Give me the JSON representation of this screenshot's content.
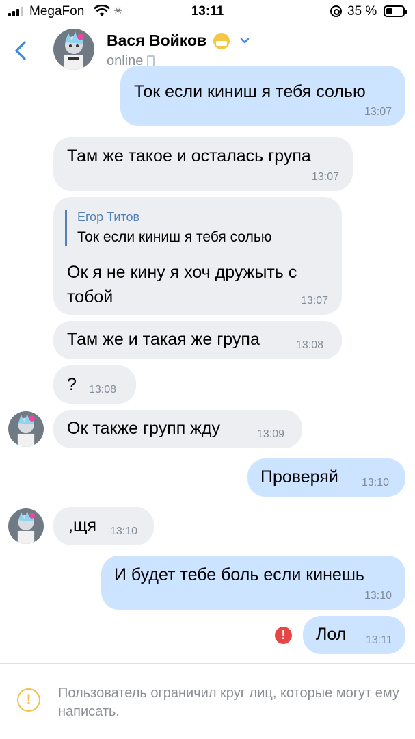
{
  "status_bar": {
    "carrier": "MegaFon",
    "time": "13:11",
    "battery": "35 %"
  },
  "header": {
    "title": "Вася Войков",
    "subtitle": "online",
    "icons": [
      "back-chevron-icon",
      "avatar",
      "mask-emoji-icon",
      "chevron-down-icon",
      "phone-icon"
    ]
  },
  "messages": [
    {
      "side": "out",
      "text": "Ток если киниш я тебя солью",
      "time": "13:07"
    },
    {
      "side": "in",
      "text": "Там же такое и осталась група",
      "time": "13:07"
    },
    {
      "side": "in",
      "reply_name": "Егор Титов",
      "reply_text": "Ток если киниш я тебя солью",
      "text": "Ок я не кину я хоч дружыть с тобой",
      "time": "13:07"
    },
    {
      "side": "in",
      "text": "Там же и такая же група",
      "time": "13:08"
    },
    {
      "side": "in",
      "text": "?",
      "time": "13:08"
    },
    {
      "side": "in",
      "text": "Ок также групп жду",
      "time": "13:09"
    },
    {
      "side": "out",
      "text": "Проверяй",
      "time": "13:10"
    },
    {
      "side": "in",
      "text": ",щя",
      "time": "13:10"
    },
    {
      "side": "out",
      "text": "И будет тебе боль если кинешь",
      "time": "13:10"
    },
    {
      "side": "out",
      "text": "Лол",
      "time": "13:11",
      "status": "error"
    }
  ],
  "footer": {
    "notice": "Пользователь ограничил круг лиц, которые могут ему написать."
  },
  "colors": {
    "incoming": "#eceef1",
    "outgoing": "#cce4ff",
    "accent": "#5181b8",
    "error": "#e64646",
    "warning": "#f4c04a"
  }
}
